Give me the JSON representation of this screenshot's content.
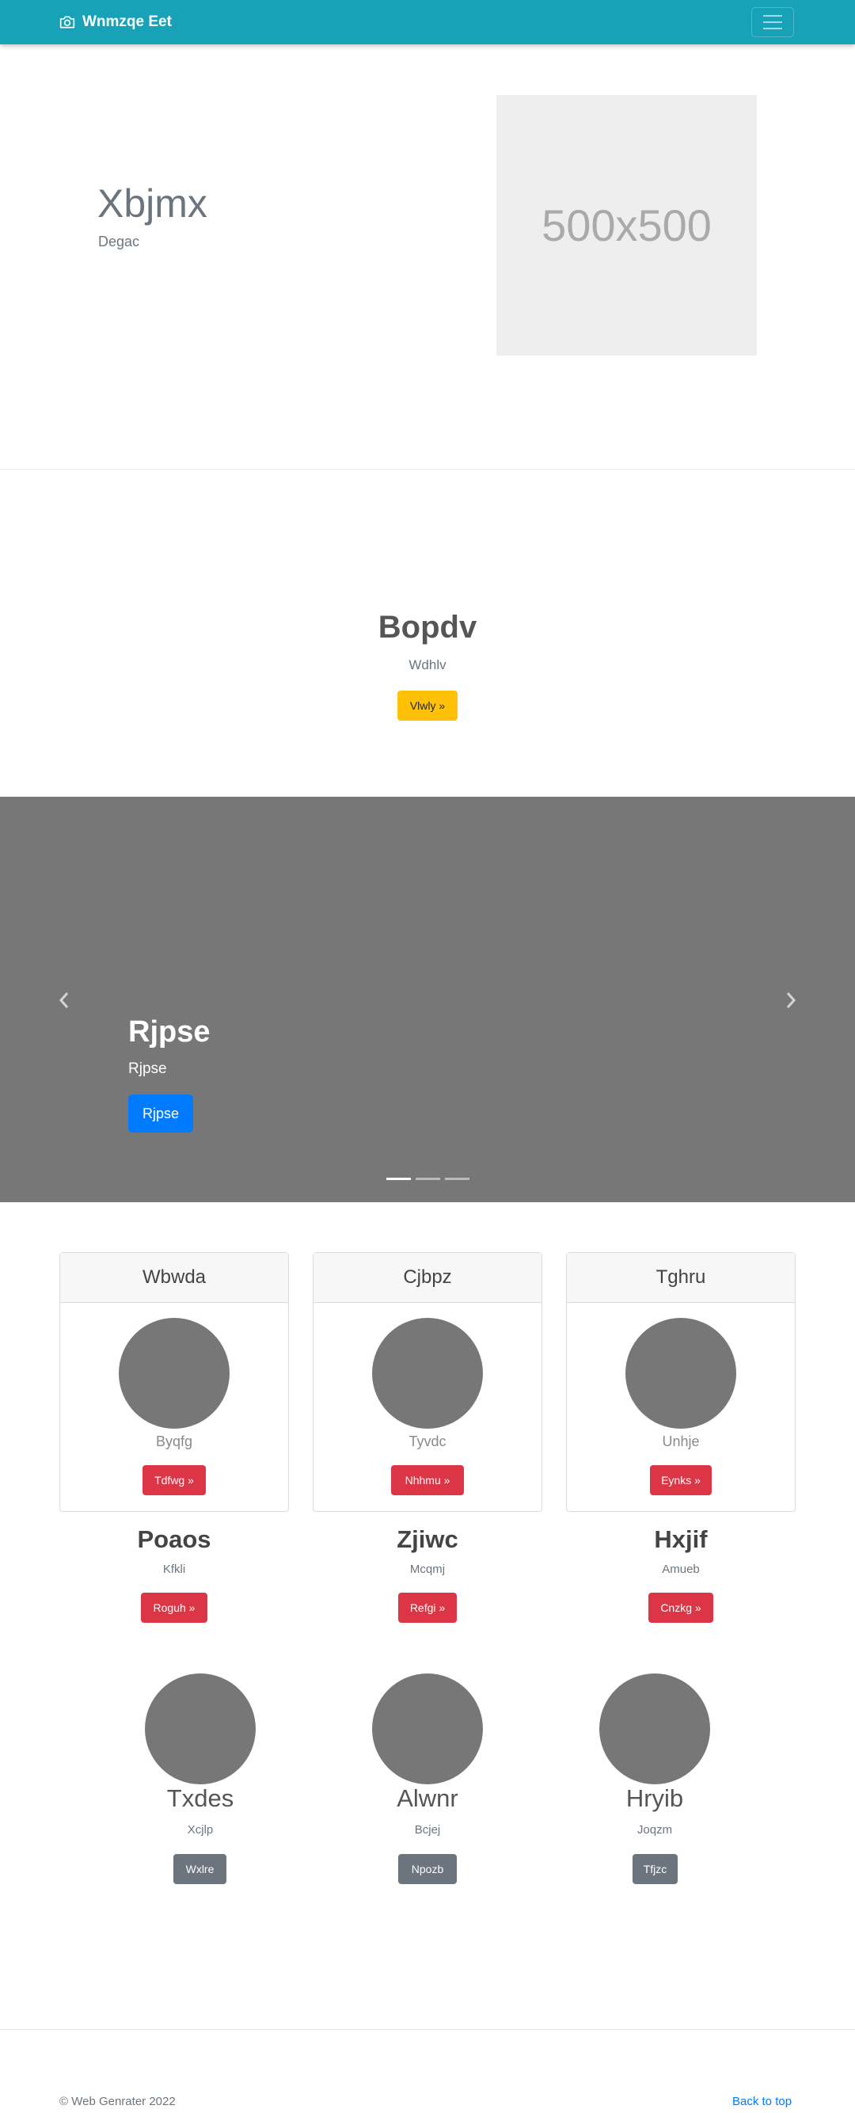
{
  "navbar": {
    "brand": "Wnmzqe Eet",
    "brand_icon": "camera-icon",
    "bg": "#17a2b8"
  },
  "hero": {
    "title": "Xbjmx",
    "subtitle": "Degac",
    "placeholder_text": "500x500"
  },
  "cta": {
    "title": "Bopdv",
    "subtitle": "Wdhlv",
    "button": "Vlwly »"
  },
  "carousel": {
    "title": "Rjpse",
    "subtitle": "Rjpse",
    "button": "Rjpse",
    "slide_count": 3,
    "active_slide": 1
  },
  "cards": [
    {
      "header": "Wbwda",
      "subtitle": "Byqfg",
      "button": "Tdfwg »"
    },
    {
      "header": "Cjbpz",
      "subtitle": "Tyvdc",
      "button": "Nhhmu »"
    },
    {
      "header": "Tghru",
      "subtitle": "Unhje",
      "button": "Eynks »"
    }
  ],
  "features": [
    {
      "title": "Poaos",
      "subtitle": "Kfkli",
      "button": "Roguh »"
    },
    {
      "title": "Zjiwc",
      "subtitle": "Mcqmj",
      "button": "Refgi »"
    },
    {
      "title": "Hxjif",
      "subtitle": "Amueb",
      "button": "Cnzkg »"
    }
  ],
  "team": [
    {
      "name": "Txdes",
      "subtitle": "Xcjlp",
      "button": "Wxlre"
    },
    {
      "name": "Alwnr",
      "subtitle": "Bcjej",
      "button": "Npozb"
    },
    {
      "name": "Hryib",
      "subtitle": "Joqzm",
      "button": "Tfjzc"
    }
  ],
  "footer": {
    "copyright": "© Web Genrater 2022",
    "back_to_top": "Back to top"
  }
}
